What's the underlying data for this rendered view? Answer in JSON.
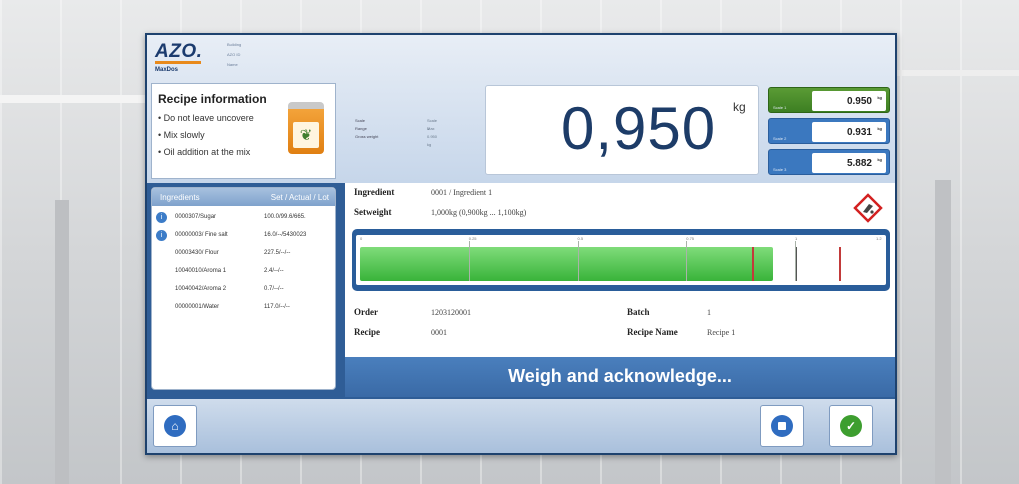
{
  "logo": {
    "brand": "AZO.",
    "product": "MaxDos",
    "tiny": [
      "Building",
      "AZO ID",
      "Name"
    ]
  },
  "recipe_info": {
    "title": "Recipe information",
    "items": [
      "Do not leave uncovere",
      "Mix slowly",
      "Oil addition at the mix"
    ]
  },
  "scale_meta": {
    "rows": [
      {
        "label": "Scale",
        "value": "Scale 1"
      },
      {
        "label": "Range",
        "value": "Max"
      },
      {
        "label": "Gross weight",
        "value": "0.950 kg"
      }
    ]
  },
  "weight": {
    "value": "0,950",
    "unit": "kg"
  },
  "scales": [
    {
      "label": "Scale 1",
      "value": "0.950",
      "unit": "kg"
    },
    {
      "label": "Scale 2",
      "value": "0.931",
      "unit": "kg"
    },
    {
      "label": "Scale 3",
      "value": "5.882",
      "unit": "kg"
    }
  ],
  "ingredients_panel": {
    "header_left": "Ingredients",
    "header_right": "Set / Actual / Lot",
    "rows": [
      {
        "name": "0000307/Sugar",
        "value": "100.0/99.6/665.",
        "icon": "check"
      },
      {
        "name": "00000003/ Fine salt",
        "value": "16.0/--/5430023",
        "icon": "check"
      },
      {
        "name": "00003430/ Flour",
        "value": "227.5/--/--",
        "icon": ""
      },
      {
        "name": "10040010/Aroma 1",
        "value": "2.4/--/--",
        "icon": ""
      },
      {
        "name": "10040042/Aroma 2",
        "value": "0.7/--/--",
        "icon": ""
      },
      {
        "name": "00000001/Water",
        "value": "117.0/--/--",
        "icon": ""
      }
    ]
  },
  "detail": {
    "ingredient_label": "Ingredient",
    "ingredient_value": "0001 / Ingredient 1",
    "setweight_label": "Setweight",
    "setweight_value": "1,000kg (0,900kg ... 1,100kg)",
    "order_label": "Order",
    "order_value": "1203120001",
    "recipe_label": "Recipe",
    "recipe_value": "0001",
    "batch_label": "Batch",
    "batch_value": "1",
    "recipe_name_label": "Recipe Name",
    "recipe_name_value": "Recipe 1"
  },
  "progress": {
    "fraction": 0.95,
    "lower_tolerance": 0.9,
    "setpoint": 1.0,
    "upper_tolerance": 1.1,
    "max": 1.2,
    "tick_labels": [
      "0",
      "0.25",
      "0.5",
      "0.75",
      "1",
      "1.2"
    ]
  },
  "ack": {
    "text": "Weigh and acknowledge..."
  },
  "colors": {
    "frame": "#2f5d96",
    "accent": "#3b78bf",
    "ok_green": "#3d9e2f",
    "bar_green": "#39b33a"
  }
}
